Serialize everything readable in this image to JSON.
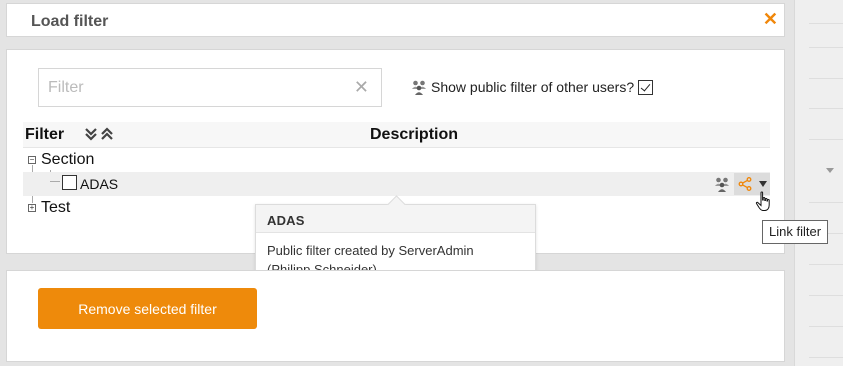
{
  "dialog": {
    "title": "Load filter"
  },
  "search": {
    "placeholder": "Filter",
    "value": ""
  },
  "public_toggle": {
    "label": "Show public filter of other users?",
    "checked": true
  },
  "table": {
    "columns": {
      "filter": "Filter",
      "description": "Description"
    },
    "tree": [
      {
        "label": "Section",
        "expanded": true,
        "children": [
          {
            "label": "ADAS",
            "checked": false,
            "public": true
          }
        ]
      },
      {
        "label": "Test",
        "expanded": false
      }
    ]
  },
  "popover": {
    "title": "ADAS",
    "body_line1": "Public filter created by ServerAdmin",
    "body_line2": "(Philipp Schneider)"
  },
  "tooltip": {
    "text": "Link filter"
  },
  "actions": {
    "remove_label": "Remove selected filter"
  },
  "colors": {
    "accent": "#ee8a0b",
    "close": "#f0870a",
    "share": "#f0870a"
  }
}
